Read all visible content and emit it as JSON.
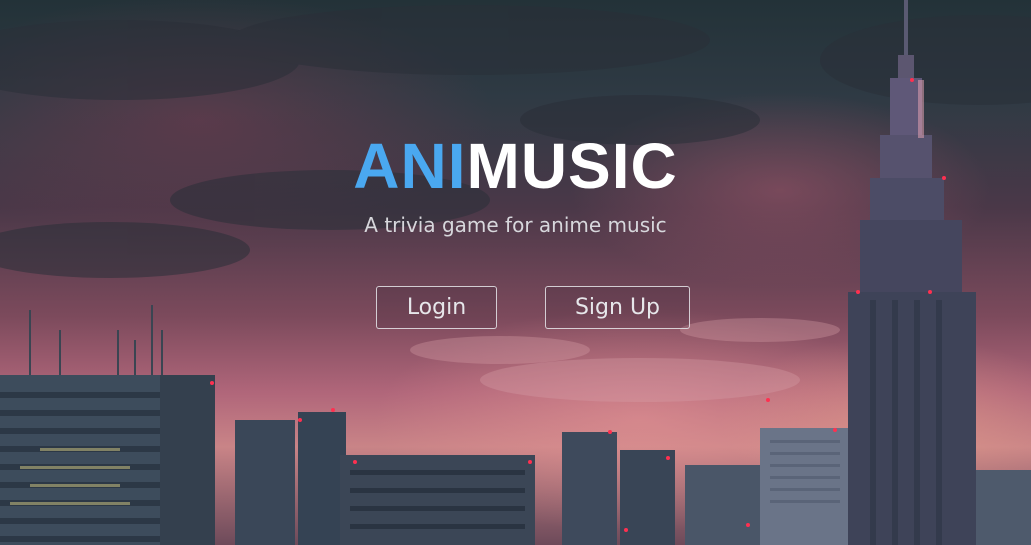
{
  "brand": {
    "accent_part": "ANI",
    "main_part": "MUSIC",
    "accent_color": "#4aa8f0"
  },
  "tagline": "A trivia game for anime music",
  "buttons": {
    "login_label": "Login",
    "signup_label": "Sign Up"
  }
}
